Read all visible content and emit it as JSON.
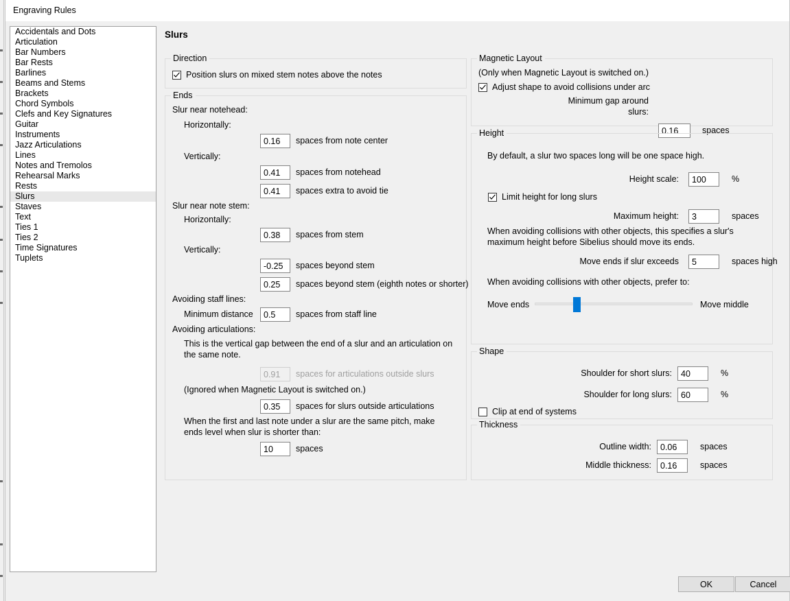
{
  "window": {
    "title": "Engraving Rules"
  },
  "sidebar": {
    "items": [
      {
        "label": "Accidentals and Dots",
        "selected": false
      },
      {
        "label": "Articulation",
        "selected": false
      },
      {
        "label": "Bar Numbers",
        "selected": false
      },
      {
        "label": "Bar Rests",
        "selected": false
      },
      {
        "label": "Barlines",
        "selected": false
      },
      {
        "label": "Beams and Stems",
        "selected": false
      },
      {
        "label": "Brackets",
        "selected": false
      },
      {
        "label": "Chord Symbols",
        "selected": false
      },
      {
        "label": "Clefs and Key Signatures",
        "selected": false
      },
      {
        "label": "Guitar",
        "selected": false
      },
      {
        "label": "Instruments",
        "selected": false
      },
      {
        "label": "Jazz Articulations",
        "selected": false
      },
      {
        "label": "Lines",
        "selected": false
      },
      {
        "label": "Notes and Tremolos",
        "selected": false
      },
      {
        "label": "Rehearsal Marks",
        "selected": false
      },
      {
        "label": "Rests",
        "selected": false
      },
      {
        "label": "Slurs",
        "selected": true
      },
      {
        "label": "Staves",
        "selected": false
      },
      {
        "label": "Text",
        "selected": false
      },
      {
        "label": "Ties 1",
        "selected": false
      },
      {
        "label": "Ties 2",
        "selected": false
      },
      {
        "label": "Time Signatures",
        "selected": false
      },
      {
        "label": "Tuplets",
        "selected": false
      }
    ]
  },
  "page": {
    "title": "Slurs"
  },
  "direction": {
    "legend": "Direction",
    "position_slurs_label": "Position slurs on mixed stem notes above the notes",
    "position_slurs_checked": true
  },
  "ends": {
    "legend": "Ends",
    "slur_near_notehead_label": "Slur near notehead:",
    "notehead_horizontally_label": "Horizontally:",
    "notehead_h_value": "0.16",
    "notehead_h_suffix": "spaces from note center",
    "notehead_vertically_label": "Vertically:",
    "notehead_v_value": "0.41",
    "notehead_v_suffix": "spaces from notehead",
    "notehead_tie_value": "0.41",
    "notehead_tie_suffix": "spaces extra to avoid tie",
    "slur_near_stem_label": "Slur near note stem:",
    "stem_horizontally_label": "Horizontally:",
    "stem_h_value": "0.38",
    "stem_h_suffix": "spaces from stem",
    "stem_vertically_label": "Vertically:",
    "stem_v_value": "-0.25",
    "stem_v_suffix": "spaces beyond stem",
    "stem_v8_value": "0.25",
    "stem_v8_suffix": "spaces beyond stem (eighth notes or shorter)",
    "avoiding_staff_lines_label": "Avoiding staff lines:",
    "minimum_distance_label": "Minimum distance",
    "minimum_distance_value": "0.5",
    "minimum_distance_suffix": "spaces from staff line",
    "avoiding_articulations_label": "Avoiding articulations:",
    "articulation_note": "This is the vertical gap between the end of a slur and an articulation on the same note.",
    "artic_outside_value": "0.91",
    "artic_outside_suffix": "spaces for articulations outside slurs",
    "artic_outside_disabled": true,
    "ignored_note": "(Ignored when Magnetic Layout is switched on.)",
    "slurs_outside_value": "0.35",
    "slurs_outside_suffix": "spaces for slurs outside articulations",
    "same_pitch_note": "When the first and last note under a slur are the same pitch, make ends level when slur is shorter than:",
    "same_pitch_value": "10",
    "same_pitch_suffix": "spaces"
  },
  "magnetic_layout": {
    "legend": "Magnetic Layout",
    "only_when_note": "(Only when Magnetic Layout is switched on.)",
    "adjust_shape_label": "Adjust shape to avoid collisions under arc",
    "adjust_shape_checked": true,
    "minimum_gap_label_line1": "Minimum gap around",
    "minimum_gap_label_line2": "slurs:",
    "minimum_gap_value": "0.16",
    "minimum_gap_suffix": "spaces"
  },
  "height": {
    "legend": "Height",
    "default_note": "By default, a slur two spaces long will be one space high.",
    "height_scale_label": "Height scale:",
    "height_scale_value": "100",
    "height_scale_suffix": "%",
    "limit_height_label": "Limit height for long slurs",
    "limit_height_checked": true,
    "maximum_height_label": "Maximum height:",
    "maximum_height_value": "3",
    "maximum_height_suffix": "spaces",
    "collision_note": "When avoiding collisions with other objects, this specifies a slur's maximum height before Sibelius should move its ends.",
    "move_ends_label": "Move ends if slur exceeds",
    "move_ends_value": "5",
    "move_ends_suffix": "spaces high",
    "prefer_note": "When avoiding collisions with other objects, prefer to:",
    "slider_left_label": "Move ends",
    "slider_right_label": "Move middle",
    "slider_position_percent": 24
  },
  "shape": {
    "legend": "Shape",
    "shoulder_short_label": "Shoulder for short slurs:",
    "shoulder_short_value": "40",
    "shoulder_short_suffix": "%",
    "shoulder_long_label": "Shoulder for long slurs:",
    "shoulder_long_value": "60",
    "shoulder_long_suffix": "%",
    "clip_label": "Clip at end of systems",
    "clip_checked": false
  },
  "thickness": {
    "legend": "Thickness",
    "outline_width_label": "Outline width:",
    "outline_width_value": "0.06",
    "outline_width_suffix": "spaces",
    "middle_thickness_label": "Middle thickness:",
    "middle_thickness_value": "0.16",
    "middle_thickness_suffix": "spaces"
  },
  "footer": {
    "ok_label": "OK",
    "cancel_label": "Cancel"
  },
  "colors": {
    "accent": "#0078d7",
    "dialog_bg": "#f0f0f0",
    "selection_bg": "#e8e8e8"
  }
}
